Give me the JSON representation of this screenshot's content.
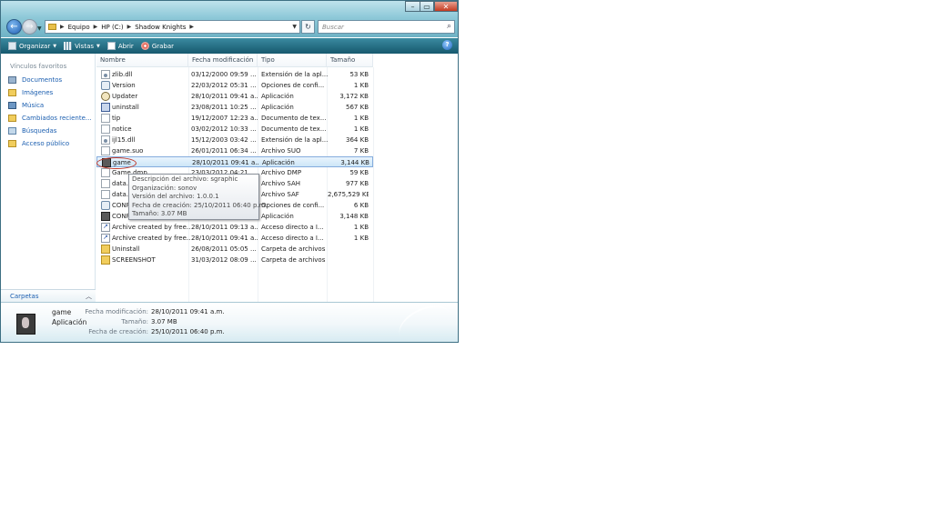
{
  "window": {
    "breadcrumb": [
      "Equipo",
      "HP (C:)",
      "Shadow Knights"
    ],
    "search_placeholder": "Buscar",
    "controls": {
      "minimize": "–",
      "maximize": "▭",
      "close": "✕"
    }
  },
  "toolbar": {
    "organize": "Organizar",
    "views": "Vistas",
    "open": "Abrir",
    "burn": "Grabar",
    "help": "?"
  },
  "nav": {
    "favorites_title": "Vínculos favoritos",
    "favorites": [
      "Documentos",
      "Imágenes",
      "Música",
      "Cambiados reciente...",
      "Búsquedas",
      "Acceso público"
    ],
    "folders": "Carpetas"
  },
  "columns": {
    "name": "Nombre",
    "date": "Fecha modificación",
    "type": "Tipo",
    "size": "Tamaño"
  },
  "files": [
    {
      "name": "zlib.dll",
      "date": "03/12/2000 09:59 ...",
      "type": "Extensión de la apl...",
      "size": "53 KB",
      "icon": "dll-icon"
    },
    {
      "name": "Version",
      "date": "22/03/2012 05:31 ...",
      "type": "Opciones de confi...",
      "size": "1 KB",
      "icon": "config-icon"
    },
    {
      "name": "Updater",
      "date": "28/10/2011 09:41 a...",
      "type": "Aplicación",
      "size": "3,172 KB",
      "icon": "updater-icon"
    },
    {
      "name": "uninstall",
      "date": "23/08/2011 10:25 ...",
      "type": "Aplicación",
      "size": "567 KB",
      "icon": "uninstall-icon"
    },
    {
      "name": "tip",
      "date": "19/12/2007 12:23 a...",
      "type": "Documento de tex...",
      "size": "1 KB",
      "icon": "text-file-icon"
    },
    {
      "name": "notice",
      "date": "03/02/2012 10:33 ...",
      "type": "Documento de tex...",
      "size": "1 KB",
      "icon": "text-file-icon"
    },
    {
      "name": "ijl15.dll",
      "date": "15/12/2003 03:42 ...",
      "type": "Extensión de la apl...",
      "size": "364 KB",
      "icon": "dll-icon"
    },
    {
      "name": "game.suo",
      "date": "26/01/2011 06:34 ...",
      "type": "Archivo SUO",
      "size": "7 KB",
      "icon": "file-icon"
    },
    {
      "name": "game",
      "date": "28/10/2011 09:41 a...",
      "type": "Aplicación",
      "size": "3,144 KB",
      "icon": "game-app-icon",
      "selected": true
    },
    {
      "name": "Game.dmp",
      "date": "23/03/2012 04:21 ...",
      "type": "Archivo DMP",
      "size": "59 KB",
      "icon": "file-icon"
    },
    {
      "name": "data.sah",
      "date": "",
      "type": "Archivo SAH",
      "size": "977 KB",
      "icon": "file-icon"
    },
    {
      "name": "data.saf",
      "date": "",
      "type": "Archivo SAF",
      "size": "2,675,529 KB",
      "icon": "file-icon"
    },
    {
      "name": "CONFIG",
      "date": "",
      "type": "Opciones de confi...",
      "size": "6 KB",
      "icon": "config-icon"
    },
    {
      "name": "CONFIG",
      "date": "",
      "type": "Aplicación",
      "size": "3,148 KB",
      "icon": "app-icon"
    },
    {
      "name": "Archive created by free...",
      "date": "28/10/2011 09:13 a...",
      "type": "Acceso directo a I...",
      "size": "1 KB",
      "icon": "shortcut-icon"
    },
    {
      "name": "Archive created by free...",
      "date": "28/10/2011 09:41 a...",
      "type": "Acceso directo a I...",
      "size": "1 KB",
      "icon": "shortcut-icon"
    },
    {
      "name": "Uninstall",
      "date": "26/08/2011 05:05 ...",
      "type": "Carpeta de archivos",
      "size": "",
      "icon": "folder-icon"
    },
    {
      "name": "SCREENSHOT",
      "date": "31/03/2012 08:09 ...",
      "type": "Carpeta de archivos",
      "size": "",
      "icon": "folder-icon"
    }
  ],
  "tooltip": [
    "Descripción del archivo: sgraphic",
    "Organización: sonov",
    "Versión del archivo: 1.0.0.1",
    "Fecha de creación: 25/10/2011 06:40 p.m.",
    "Tamaño: 3.07 MB"
  ],
  "details": {
    "name": "game",
    "type": "Aplicación",
    "modified_label": "Fecha modificación:",
    "modified_value": "28/10/2011 09:41 a.m.",
    "size_label": "Tamaño:",
    "size_value": "3.07 MB",
    "created_label": "Fecha de creación:",
    "created_value": "25/10/2011 06:40 p.m."
  }
}
